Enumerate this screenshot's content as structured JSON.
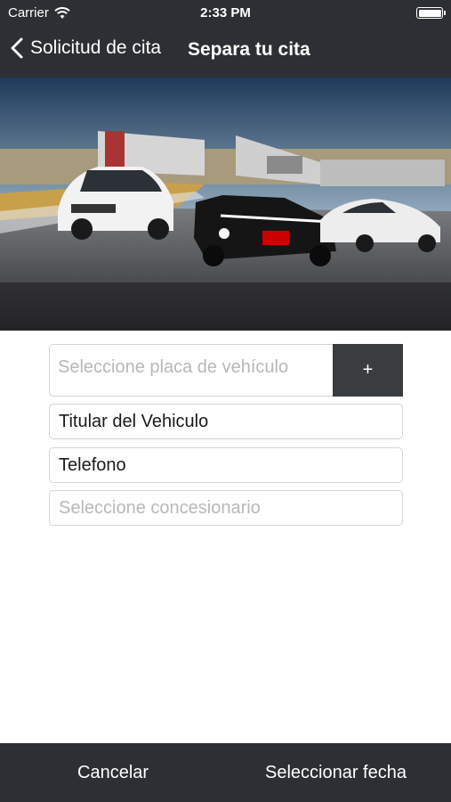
{
  "status_bar": {
    "carrier": "Carrier",
    "time": "2:33 PM",
    "icons": [
      "wifi-icon",
      "battery-icon"
    ]
  },
  "nav": {
    "back_label": "Solicitud de cita",
    "title": "Separa tu cita",
    "back_icon": "chevron-left-icon"
  },
  "hero": {
    "description_icon": "race-cars-photo"
  },
  "form": {
    "plate_placeholder": "Seleccione placa de vehículo",
    "add_label": "+",
    "owner_value": "Titular del Vehiculo",
    "phone_value": "Telefono",
    "dealer_placeholder": "Seleccione concesionario"
  },
  "bottom_bar": {
    "cancel_label": "Cancelar",
    "select_date_label": "Seleccionar fecha"
  },
  "colors": {
    "bar_background": "#2c2f33",
    "add_button": "#3a3d40",
    "field_border": "#d4d4d4",
    "placeholder": "#b8b8b8"
  }
}
